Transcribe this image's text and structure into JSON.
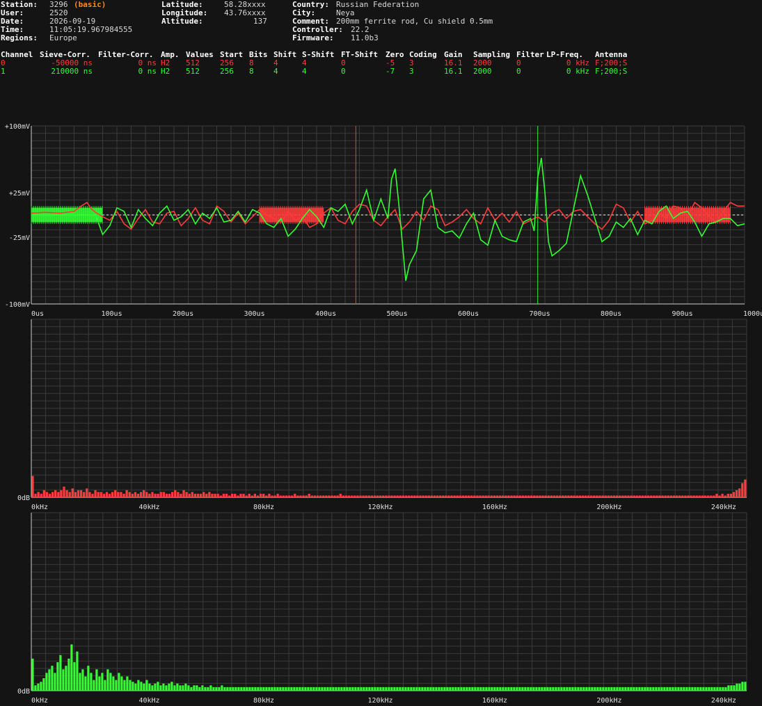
{
  "station_info": {
    "station_label": "Station:",
    "station": "3296",
    "station_tag": "(basic)",
    "user_label": "User:",
    "user": "2520",
    "date_label": "Date:",
    "date": "2026-09-19",
    "time_label": "Time:",
    "time": "11:05:19.967984555",
    "regions_label": "Regions:",
    "regions": "Europe",
    "latitude_label": "Latitude:",
    "latitude": "58.28xxxx",
    "longitude_label": "Longitude:",
    "longitude": "43.76xxxx",
    "altitude_label": "Altitude:",
    "altitude": "137",
    "country_label": "Country:",
    "country": "Russian Federation",
    "city_label": "City:",
    "city": "Neya",
    "comment_label": "Comment:",
    "comment": "200mm ferrite rod, Cu shield 0.5mm",
    "controller_label": "Controller:",
    "controller": "22.2",
    "firmware_label": "Firmware:",
    "firmware": "11.0b3"
  },
  "channel_table": {
    "headers": [
      "Channel",
      "Sieve-Corr.",
      "Filter-Corr.",
      "Amp.",
      "Values",
      "Start",
      "Bits",
      "Shift",
      "S-Shift",
      "FT-Shift",
      "Zero",
      "Coding",
      "Gain",
      "Sampling",
      "Filter",
      "LP-Freq.",
      "Antenna"
    ],
    "rows": [
      {
        "color": "#ff3b3b",
        "cells": [
          "0",
          "-50000 ns",
          "0 ns",
          "H2",
          "512",
          "256",
          "8",
          "4",
          "4",
          "0",
          "-5",
          "3",
          "16.1",
          "2000",
          "0",
          "0 kHz",
          "F;200;S"
        ]
      },
      {
        "color": "#33ff33",
        "cells": [
          "1",
          "210000 ns",
          "0 ns",
          "H2",
          "512",
          "256",
          "8",
          "4",
          "4",
          "0",
          "-7",
          "3",
          "16.1",
          "2000",
          "0",
          "0 kHz",
          "F;200;S"
        ]
      }
    ]
  },
  "chart_data": [
    {
      "type": "line",
      "title": "",
      "xlabel": "",
      "ylabel": "",
      "xlim": [
        0,
        1000
      ],
      "ylim": [
        -100,
        100
      ],
      "x_ticks": [
        "0us",
        "100us",
        "200us",
        "300us",
        "400us",
        "500us",
        "600us",
        "700us",
        "800us",
        "900us",
        "1000us"
      ],
      "y_ticks": [
        "+100mV",
        "+25mV",
        "-25mV",
        "-100mV"
      ],
      "y_tick_values": [
        100,
        25,
        -25,
        -100
      ],
      "markers": [
        {
          "x": 455,
          "color": "#ff3b3b"
        },
        {
          "x": 710,
          "color": "#33ff33"
        }
      ],
      "baseline": 0,
      "series": [
        {
          "color": "#ff3b3b",
          "x": [
            0,
            20,
            40,
            60,
            70,
            78,
            85,
            90,
            100,
            110,
            120,
            130,
            140,
            150,
            160,
            170,
            180,
            190,
            200,
            210,
            220,
            230,
            240,
            250,
            260,
            270,
            280,
            290,
            300,
            310,
            320,
            330,
            340,
            350,
            360,
            370,
            380,
            390,
            400,
            410,
            420,
            430,
            440,
            450,
            460,
            470,
            480,
            490,
            500,
            510,
            520,
            530,
            540,
            550,
            560,
            570,
            580,
            590,
            600,
            610,
            620,
            630,
            640,
            650,
            660,
            670,
            680,
            690,
            700,
            710,
            720,
            730,
            740,
            750,
            760,
            770,
            780,
            790,
            800,
            810,
            820,
            830,
            840,
            850,
            860,
            870,
            880,
            890,
            900,
            910,
            920,
            930,
            940,
            950,
            960,
            970,
            980,
            990,
            1000
          ],
          "values": [
            2,
            3,
            2,
            4,
            10,
            14,
            6,
            3,
            -2,
            -6,
            4,
            -10,
            -16,
            -4,
            6,
            -8,
            -10,
            2,
            4,
            -12,
            -4,
            8,
            -6,
            -10,
            10,
            4,
            -8,
            2,
            -10,
            -2,
            6,
            0,
            -4,
            -8,
            4,
            -6,
            -2,
            -14,
            -10,
            2,
            8,
            -6,
            -10,
            4,
            12,
            10,
            -6,
            -12,
            -2,
            6,
            -16,
            -8,
            4,
            -6,
            10,
            6,
            -12,
            -8,
            -2,
            6,
            -4,
            -10,
            8,
            -6,
            2,
            -8,
            4,
            -10,
            -6,
            -2,
            -8,
            2,
            6,
            -4,
            4,
            6,
            -2,
            -10,
            -16,
            -6,
            12,
            8,
            -8,
            4,
            -10,
            -6,
            2,
            -4,
            10,
            8,
            -2,
            14,
            8,
            -2,
            -8,
            4,
            14,
            10,
            10
          ]
        },
        {
          "color": "#33ff33",
          "x": [
            0,
            20,
            40,
            60,
            70,
            80,
            90,
            100,
            110,
            120,
            130,
            140,
            150,
            160,
            170,
            180,
            190,
            200,
            210,
            220,
            230,
            240,
            250,
            260,
            270,
            280,
            290,
            300,
            310,
            320,
            330,
            340,
            350,
            360,
            370,
            380,
            390,
            400,
            410,
            420,
            430,
            440,
            450,
            460,
            470,
            480,
            490,
            500,
            505,
            510,
            515,
            520,
            525,
            530,
            540,
            550,
            560,
            570,
            580,
            590,
            600,
            610,
            620,
            630,
            640,
            650,
            660,
            670,
            680,
            690,
            700,
            705,
            710,
            715,
            720,
            725,
            730,
            740,
            750,
            760,
            770,
            780,
            790,
            800,
            810,
            820,
            830,
            840,
            850,
            860,
            870,
            880,
            890,
            900,
            910,
            920,
            930,
            940,
            950,
            960,
            970,
            980,
            990,
            1000
          ],
          "values": [
            0,
            0,
            0,
            0,
            0,
            0,
            0,
            -22,
            -12,
            8,
            4,
            -14,
            6,
            -4,
            -12,
            2,
            10,
            -6,
            -2,
            6,
            -10,
            2,
            -4,
            8,
            -8,
            -6,
            4,
            -8,
            6,
            2,
            -10,
            -14,
            -4,
            -24,
            -16,
            -4,
            6,
            -2,
            -14,
            8,
            4,
            12,
            -10,
            6,
            28,
            -6,
            18,
            -4,
            40,
            52,
            14,
            -30,
            -74,
            -56,
            -40,
            18,
            28,
            -14,
            -20,
            -18,
            -26,
            -10,
            2,
            -28,
            -34,
            -6,
            -24,
            -28,
            -30,
            -8,
            -4,
            -18,
            42,
            64,
            26,
            -30,
            -46,
            -40,
            -32,
            6,
            44,
            22,
            -4,
            -30,
            -24,
            -8,
            -14,
            -4,
            -22,
            -6,
            -10,
            4,
            10,
            -4,
            2,
            4,
            -8,
            -24,
            -10,
            -8,
            -4,
            -4,
            -12,
            -10
          ]
        }
      ],
      "bursts": [
        {
          "x0": 0,
          "x1": 100,
          "color": "#33ff33"
        },
        {
          "x0": 320,
          "x1": 410,
          "color": "#ff3b3b"
        },
        {
          "x0": 860,
          "x1": 980,
          "color": "#ff3b3b"
        }
      ]
    },
    {
      "type": "bar",
      "title": "",
      "xlabel": "",
      "ylabel": "",
      "xlim": [
        0,
        250
      ],
      "y_ticks": [
        "0dB"
      ],
      "x_ticks": [
        "0kHz",
        "40kHz",
        "80kHz",
        "120kHz",
        "160kHz",
        "200kHz",
        "240kHz"
      ],
      "color": "#ff3b3b",
      "values": [
        12,
        2,
        3,
        2,
        4,
        3,
        2,
        3,
        4,
        3,
        4,
        6,
        4,
        3,
        5,
        3,
        4,
        4,
        3,
        5,
        3,
        2,
        4,
        3,
        3,
        2,
        3,
        2,
        3,
        4,
        3,
        3,
        2,
        4,
        3,
        2,
        3,
        2,
        3,
        4,
        3,
        2,
        3,
        2,
        2,
        3,
        3,
        2,
        2,
        3,
        4,
        3,
        2,
        4,
        3,
        2,
        3,
        2,
        2,
        2,
        3,
        2,
        3,
        2,
        2,
        2,
        1,
        2,
        2,
        1,
        2,
        2,
        1,
        2,
        2,
        1,
        2,
        1,
        2,
        1,
        2,
        2,
        1,
        2,
        1,
        1,
        2,
        1,
        1,
        1,
        1,
        1,
        2,
        1,
        1,
        1,
        1,
        2,
        1,
        1,
        1,
        1,
        1,
        1,
        1,
        1,
        1,
        1,
        2,
        1,
        1,
        1,
        1,
        1,
        1,
        1,
        1,
        1,
        1,
        1,
        1,
        1,
        1,
        1,
        1,
        1,
        1,
        1,
        1,
        1,
        1,
        1,
        1,
        1,
        1,
        1,
        1,
        1,
        1,
        1,
        1,
        1,
        1,
        1,
        1,
        1,
        1,
        1,
        1,
        1,
        1,
        1,
        1,
        1,
        1,
        1,
        1,
        1,
        1,
        1,
        1,
        1,
        1,
        1,
        1,
        1,
        1,
        1,
        1,
        1,
        1,
        1,
        1,
        1,
        1,
        1,
        1,
        1,
        1,
        1,
        1,
        1,
        1,
        1,
        1,
        1,
        1,
        1,
        1,
        1,
        1,
        1,
        1,
        1,
        1,
        1,
        1,
        1,
        1,
        1,
        1,
        1,
        1,
        1,
        1,
        1,
        1,
        1,
        1,
        1,
        1,
        1,
        1,
        1,
        1,
        1,
        1,
        1,
        1,
        1,
        1,
        1,
        1,
        1,
        1,
        1,
        1,
        1,
        1,
        1,
        1,
        1,
        1,
        1,
        1,
        1,
        1,
        1,
        1,
        1,
        2,
        1,
        2,
        1,
        2,
        2,
        3,
        4,
        5,
        8,
        10
      ]
    },
    {
      "type": "bar",
      "title": "",
      "xlabel": "",
      "ylabel": "",
      "xlim": [
        0,
        250
      ],
      "y_ticks": [
        "0dB"
      ],
      "x_ticks": [
        "0kHz",
        "40kHz",
        "80kHz",
        "120kHz",
        "160kHz",
        "200kHz",
        "240kHz"
      ],
      "color": "#33ff33",
      "values": [
        18,
        3,
        4,
        5,
        7,
        10,
        12,
        14,
        10,
        16,
        20,
        12,
        14,
        18,
        26,
        16,
        22,
        10,
        12,
        8,
        14,
        10,
        6,
        12,
        8,
        10,
        6,
        12,
        10,
        8,
        6,
        10,
        8,
        6,
        8,
        6,
        5,
        4,
        6,
        5,
        4,
        6,
        4,
        3,
        4,
        5,
        3,
        4,
        3,
        4,
        5,
        3,
        4,
        3,
        3,
        4,
        3,
        2,
        3,
        3,
        2,
        3,
        2,
        2,
        3,
        2,
        2,
        2,
        3,
        2,
        2,
        2,
        2,
        2,
        2,
        2,
        2,
        2,
        2,
        2,
        2,
        2,
        2,
        2,
        2,
        2,
        2,
        2,
        2,
        2,
        2,
        2,
        2,
        2,
        2,
        2,
        2,
        2,
        2,
        2,
        2,
        2,
        2,
        2,
        2,
        2,
        2,
        2,
        2,
        2,
        2,
        2,
        2,
        2,
        2,
        2,
        2,
        2,
        2,
        2,
        2,
        2,
        2,
        2,
        2,
        2,
        2,
        2,
        2,
        2,
        2,
        2,
        2,
        2,
        2,
        2,
        2,
        2,
        2,
        2,
        2,
        2,
        2,
        2,
        2,
        2,
        2,
        2,
        2,
        2,
        2,
        2,
        2,
        2,
        2,
        2,
        2,
        2,
        2,
        2,
        2,
        2,
        2,
        2,
        2,
        2,
        2,
        2,
        2,
        2,
        2,
        2,
        2,
        2,
        2,
        2,
        2,
        2,
        2,
        2,
        2,
        2,
        2,
        2,
        2,
        2,
        2,
        2,
        2,
        2,
        2,
        2,
        2,
        2,
        2,
        2,
        2,
        2,
        2,
        2,
        2,
        2,
        2,
        2,
        2,
        2,
        2,
        2,
        2,
        2,
        2,
        2,
        2,
        2,
        2,
        2,
        2,
        2,
        2,
        2,
        2,
        2,
        2,
        2,
        2,
        2,
        2,
        2,
        2,
        2,
        2,
        2,
        2,
        2,
        2,
        2,
        2,
        2,
        2,
        2,
        2,
        2,
        2,
        2,
        2,
        2,
        2,
        2,
        2,
        2,
        3,
        3,
        3,
        4,
        4,
        5,
        5
      ]
    }
  ]
}
